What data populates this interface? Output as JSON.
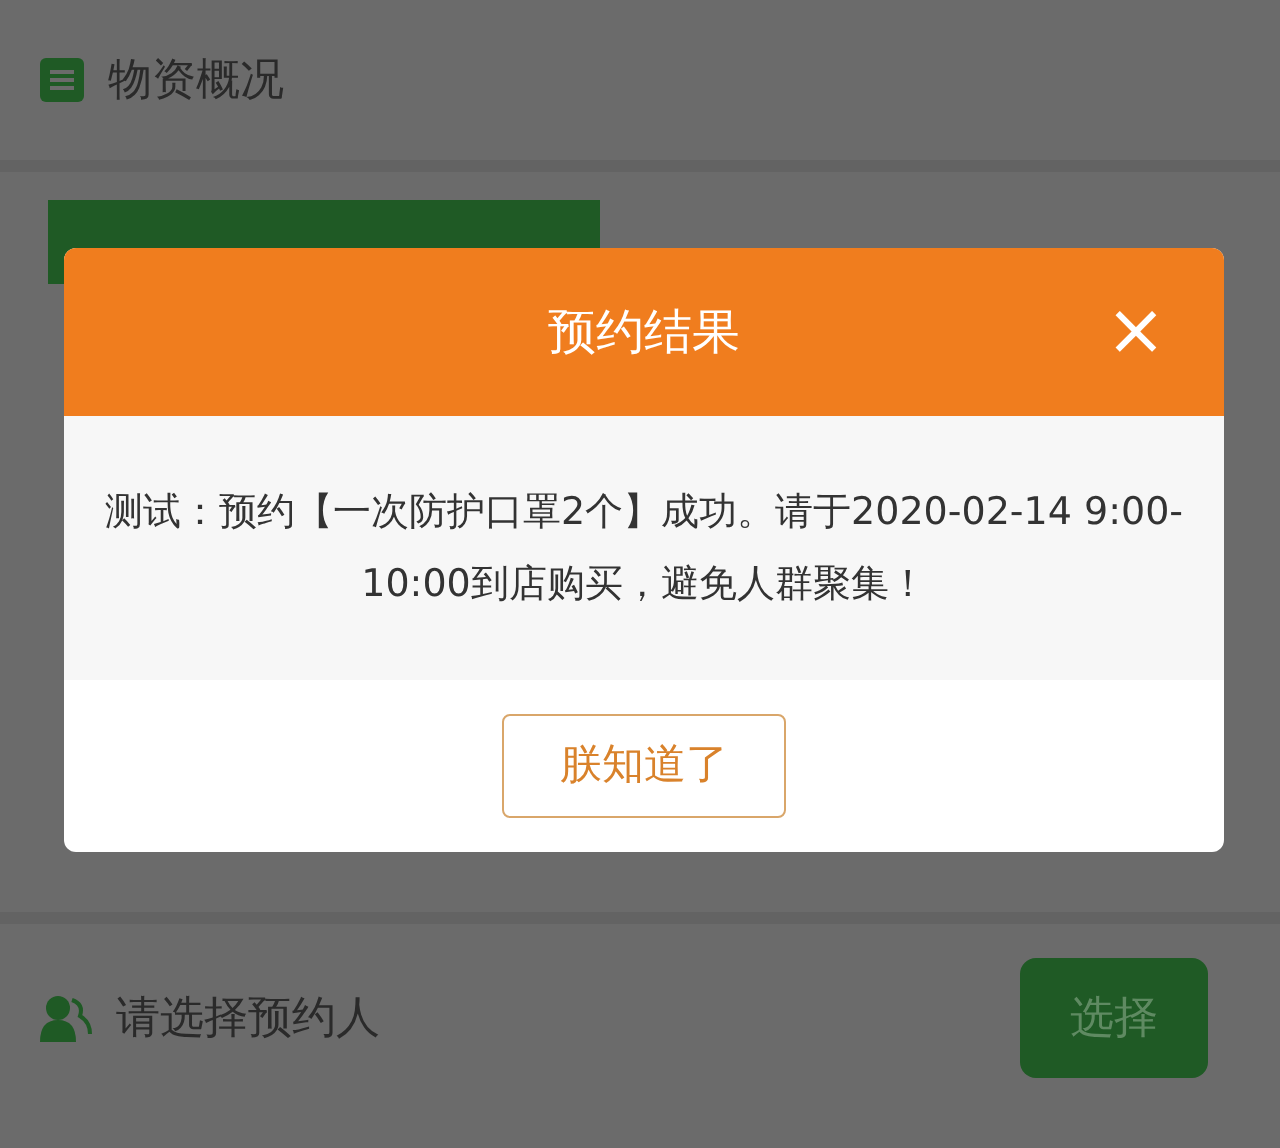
{
  "page": {
    "section_title": "物资概况",
    "reserve_label": "请选择预约人",
    "select_button": "选择"
  },
  "dialog": {
    "title": "预约结果",
    "close": "×",
    "message": "测试：预约【一次防护口罩2个】成功。请于2020-02-14 9:00-10:00到店购买，避免人群聚集！",
    "confirm": "朕知道了"
  }
}
